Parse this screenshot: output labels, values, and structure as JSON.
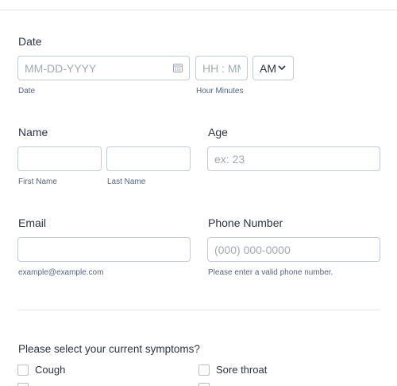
{
  "date": {
    "label": "Date",
    "date_placeholder": "MM-DD-YYYY",
    "date_sublabel": "Date",
    "time_placeholder": "HH : MM",
    "time_sublabel": "Hour Minutes",
    "ampm_value": "AM",
    "calendar_icon": "calendar-icon",
    "chevron_icon": "chevron-down-icon"
  },
  "name": {
    "label": "Name",
    "first_sublabel": "First Name",
    "last_sublabel": "Last Name"
  },
  "age": {
    "label": "Age",
    "placeholder": "ex: 23"
  },
  "email": {
    "label": "Email",
    "sublabel": "example@example.com"
  },
  "phone": {
    "label": "Phone Number",
    "placeholder": "(000) 000-0000",
    "sublabel": "Please enter a valid phone number."
  },
  "symptoms": {
    "question": "Please select your current symptoms?",
    "options": [
      {
        "label": "Cough",
        "checked": false
      },
      {
        "label": "Sore throat",
        "checked": false
      }
    ]
  },
  "colors": {
    "text": "#2c3345",
    "sublabel": "#57647e",
    "border": "#c3cad8",
    "placeholder": "#a1a9b8"
  }
}
